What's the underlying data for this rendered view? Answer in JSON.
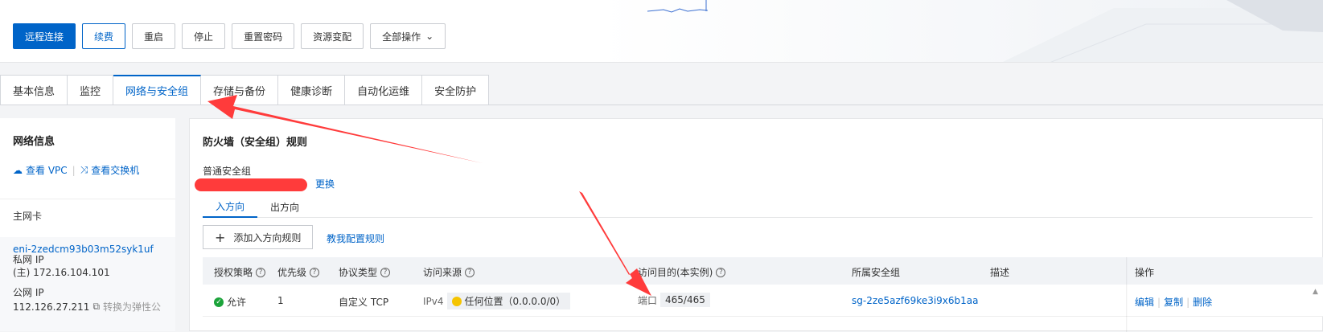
{
  "toolbar": {
    "remote": "远程连接",
    "renew": "续费",
    "restart": "重启",
    "stop": "停止",
    "reset_pwd": "重置密码",
    "resize": "资源变配",
    "all_ops": "全部操作"
  },
  "tabs": [
    {
      "label": "基本信息"
    },
    {
      "label": "监控"
    },
    {
      "label": "网络与安全组"
    },
    {
      "label": "存储与备份"
    },
    {
      "label": "健康诊断"
    },
    {
      "label": "自动化运维"
    },
    {
      "label": "安全防护"
    }
  ],
  "network_info": {
    "title": "网络信息",
    "view_vpc": "查看 VPC",
    "view_vswitch": "查看交换机",
    "primary_eni_label": "主网卡",
    "eni_id": "eni-2zedcm93b03m52syk1uf",
    "private_ip_label": "私网 IP",
    "private_ip": "(主) 172.16.104.101",
    "public_ip_label": "公网 IP",
    "public_ip": "112.126.27.211",
    "convert_eip": "转换为弹性公"
  },
  "firewall": {
    "title": "防火墙（安全组）规则",
    "sg_type": "普通安全组",
    "change": "更换",
    "dir_tabs": [
      "入方向",
      "出方向"
    ],
    "add_rule": "添加入方向规则",
    "teach": "教我配置规则",
    "columns": {
      "policy": "授权策略",
      "priority": "优先级",
      "protocol": "协议类型",
      "source": "访问来源",
      "dest": "访问目的(本实例)",
      "sg": "所属安全组",
      "desc": "描述",
      "ops": "操作"
    },
    "rows": [
      {
        "policy": "允许",
        "priority": "1",
        "protocol": "自定义 TCP",
        "ip_ver": "IPv4",
        "source": "任何位置（0.0.0.0/0）",
        "port_label": "端口",
        "port": "465/465",
        "sg": "sg-2ze5azf69ke3i9x6b1aa",
        "edit": "编辑",
        "copy": "复制",
        "delete": "删除"
      }
    ]
  },
  "colors": {
    "accent": "#0064c8",
    "annotation": "#ff3b3b",
    "ok": "#1ba33a"
  }
}
